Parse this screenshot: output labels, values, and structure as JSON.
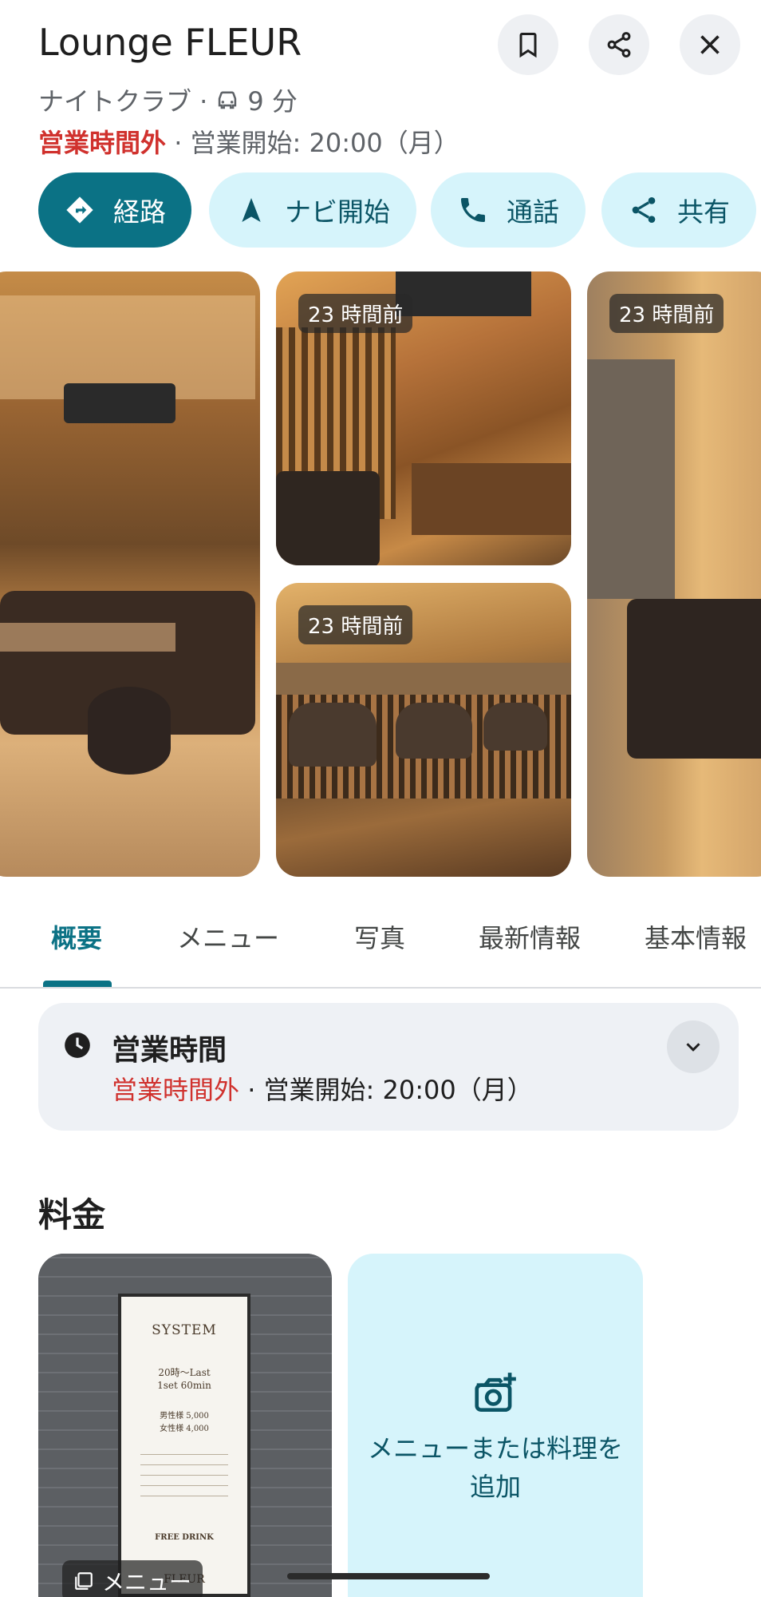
{
  "header": {
    "title": "Lounge FLEUR",
    "category": "ナイトクラブ ·",
    "drive_time": "9 分",
    "status_closed": "営業時間外",
    "status_open": " · 営業開始: 20:00（月）"
  },
  "icons": {
    "bookmark": "bookmark-icon",
    "share": "share-icon",
    "close": "close-icon",
    "car": "car-icon"
  },
  "actions": {
    "route": "経路",
    "navigate": "ナビ開始",
    "call": "通話",
    "share": "共有"
  },
  "photos": {
    "badge_1": "23 時間前",
    "badge_2": "23 時間前",
    "badge_3": "23 時間前"
  },
  "tabs": [
    "概要",
    "メニュー",
    "写真",
    "最新情報",
    "基本情報"
  ],
  "hours": {
    "title": "営業時間",
    "closed": "営業時間外",
    "open": " · 営業開始: 20:00（月）"
  },
  "price": {
    "title": "料金",
    "menu_tag": "メニュー",
    "board": {
      "title": "SYSTEM",
      "time": "20時～Last",
      "set": "1set 60min",
      "male": "男性様 5,000",
      "female": "女性様 4,000",
      "free_drink": "FREE DRINK",
      "name": "FLEUR"
    },
    "add_label": "メニューまたは料理を追加"
  },
  "colors": {
    "accent": "#0b7285",
    "chip_bg": "#d6f4fb",
    "closed_red": "#d0312d"
  }
}
